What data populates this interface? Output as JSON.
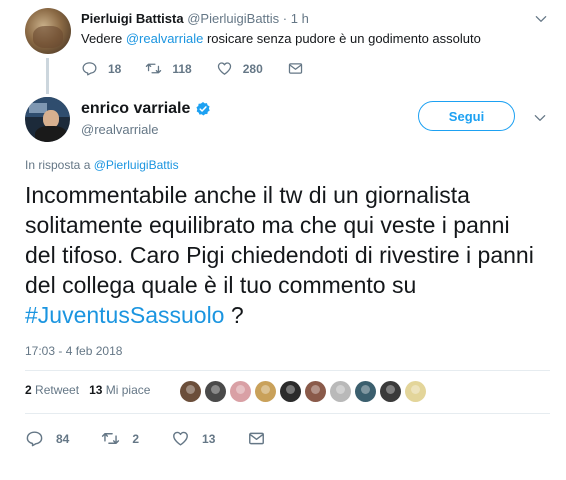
{
  "parent_tweet": {
    "name": "Pierluigi Battista",
    "handle": "@PierluigiBattis",
    "dot": "·",
    "time": "1 h",
    "text_pre": "Vedere ",
    "text_mention": "@realvarriale",
    "text_post": " rosicare senza pudore è un godimento assoluto",
    "replies": "18",
    "retweets": "118",
    "likes": "280"
  },
  "main_tweet": {
    "name": "enrico varriale",
    "handle": "@realvarriale",
    "follow_label": "Segui",
    "reply_prefix": "In risposta a ",
    "reply_mention": "@PierluigiBattis",
    "text": "Incommentabile anche il tw di un giornalista solitamente equilibrato ma che qui veste i panni del tifoso. Caro Pigi chiedendoti di rivestire i panni del collega quale è il tuo commento su ",
    "hashtag": "#JuventusSassuolo",
    "text_end": " ?",
    "timestamp": "17:03 - 4 feb 2018",
    "retweet_count": "2",
    "retweet_label": "Retweet",
    "like_count": "13",
    "like_label": "Mi piace",
    "replies": "84",
    "retweets": "2",
    "likes": "13"
  },
  "likers": [
    {
      "color": "#6b4e3a"
    },
    {
      "color": "#4a4a4a"
    },
    {
      "color": "#d9a0a5"
    },
    {
      "color": "#c9a15a"
    },
    {
      "color": "#2b2b2b"
    },
    {
      "color": "#8a5a4a"
    },
    {
      "color": "#b9b9b9"
    },
    {
      "color": "#3b5f6e"
    },
    {
      "color": "#3a3a3a"
    },
    {
      "color": "#e3d59a"
    }
  ],
  "colors": {
    "accent": "#1da1f2",
    "link": "#1b95e0",
    "muted": "#657786"
  }
}
